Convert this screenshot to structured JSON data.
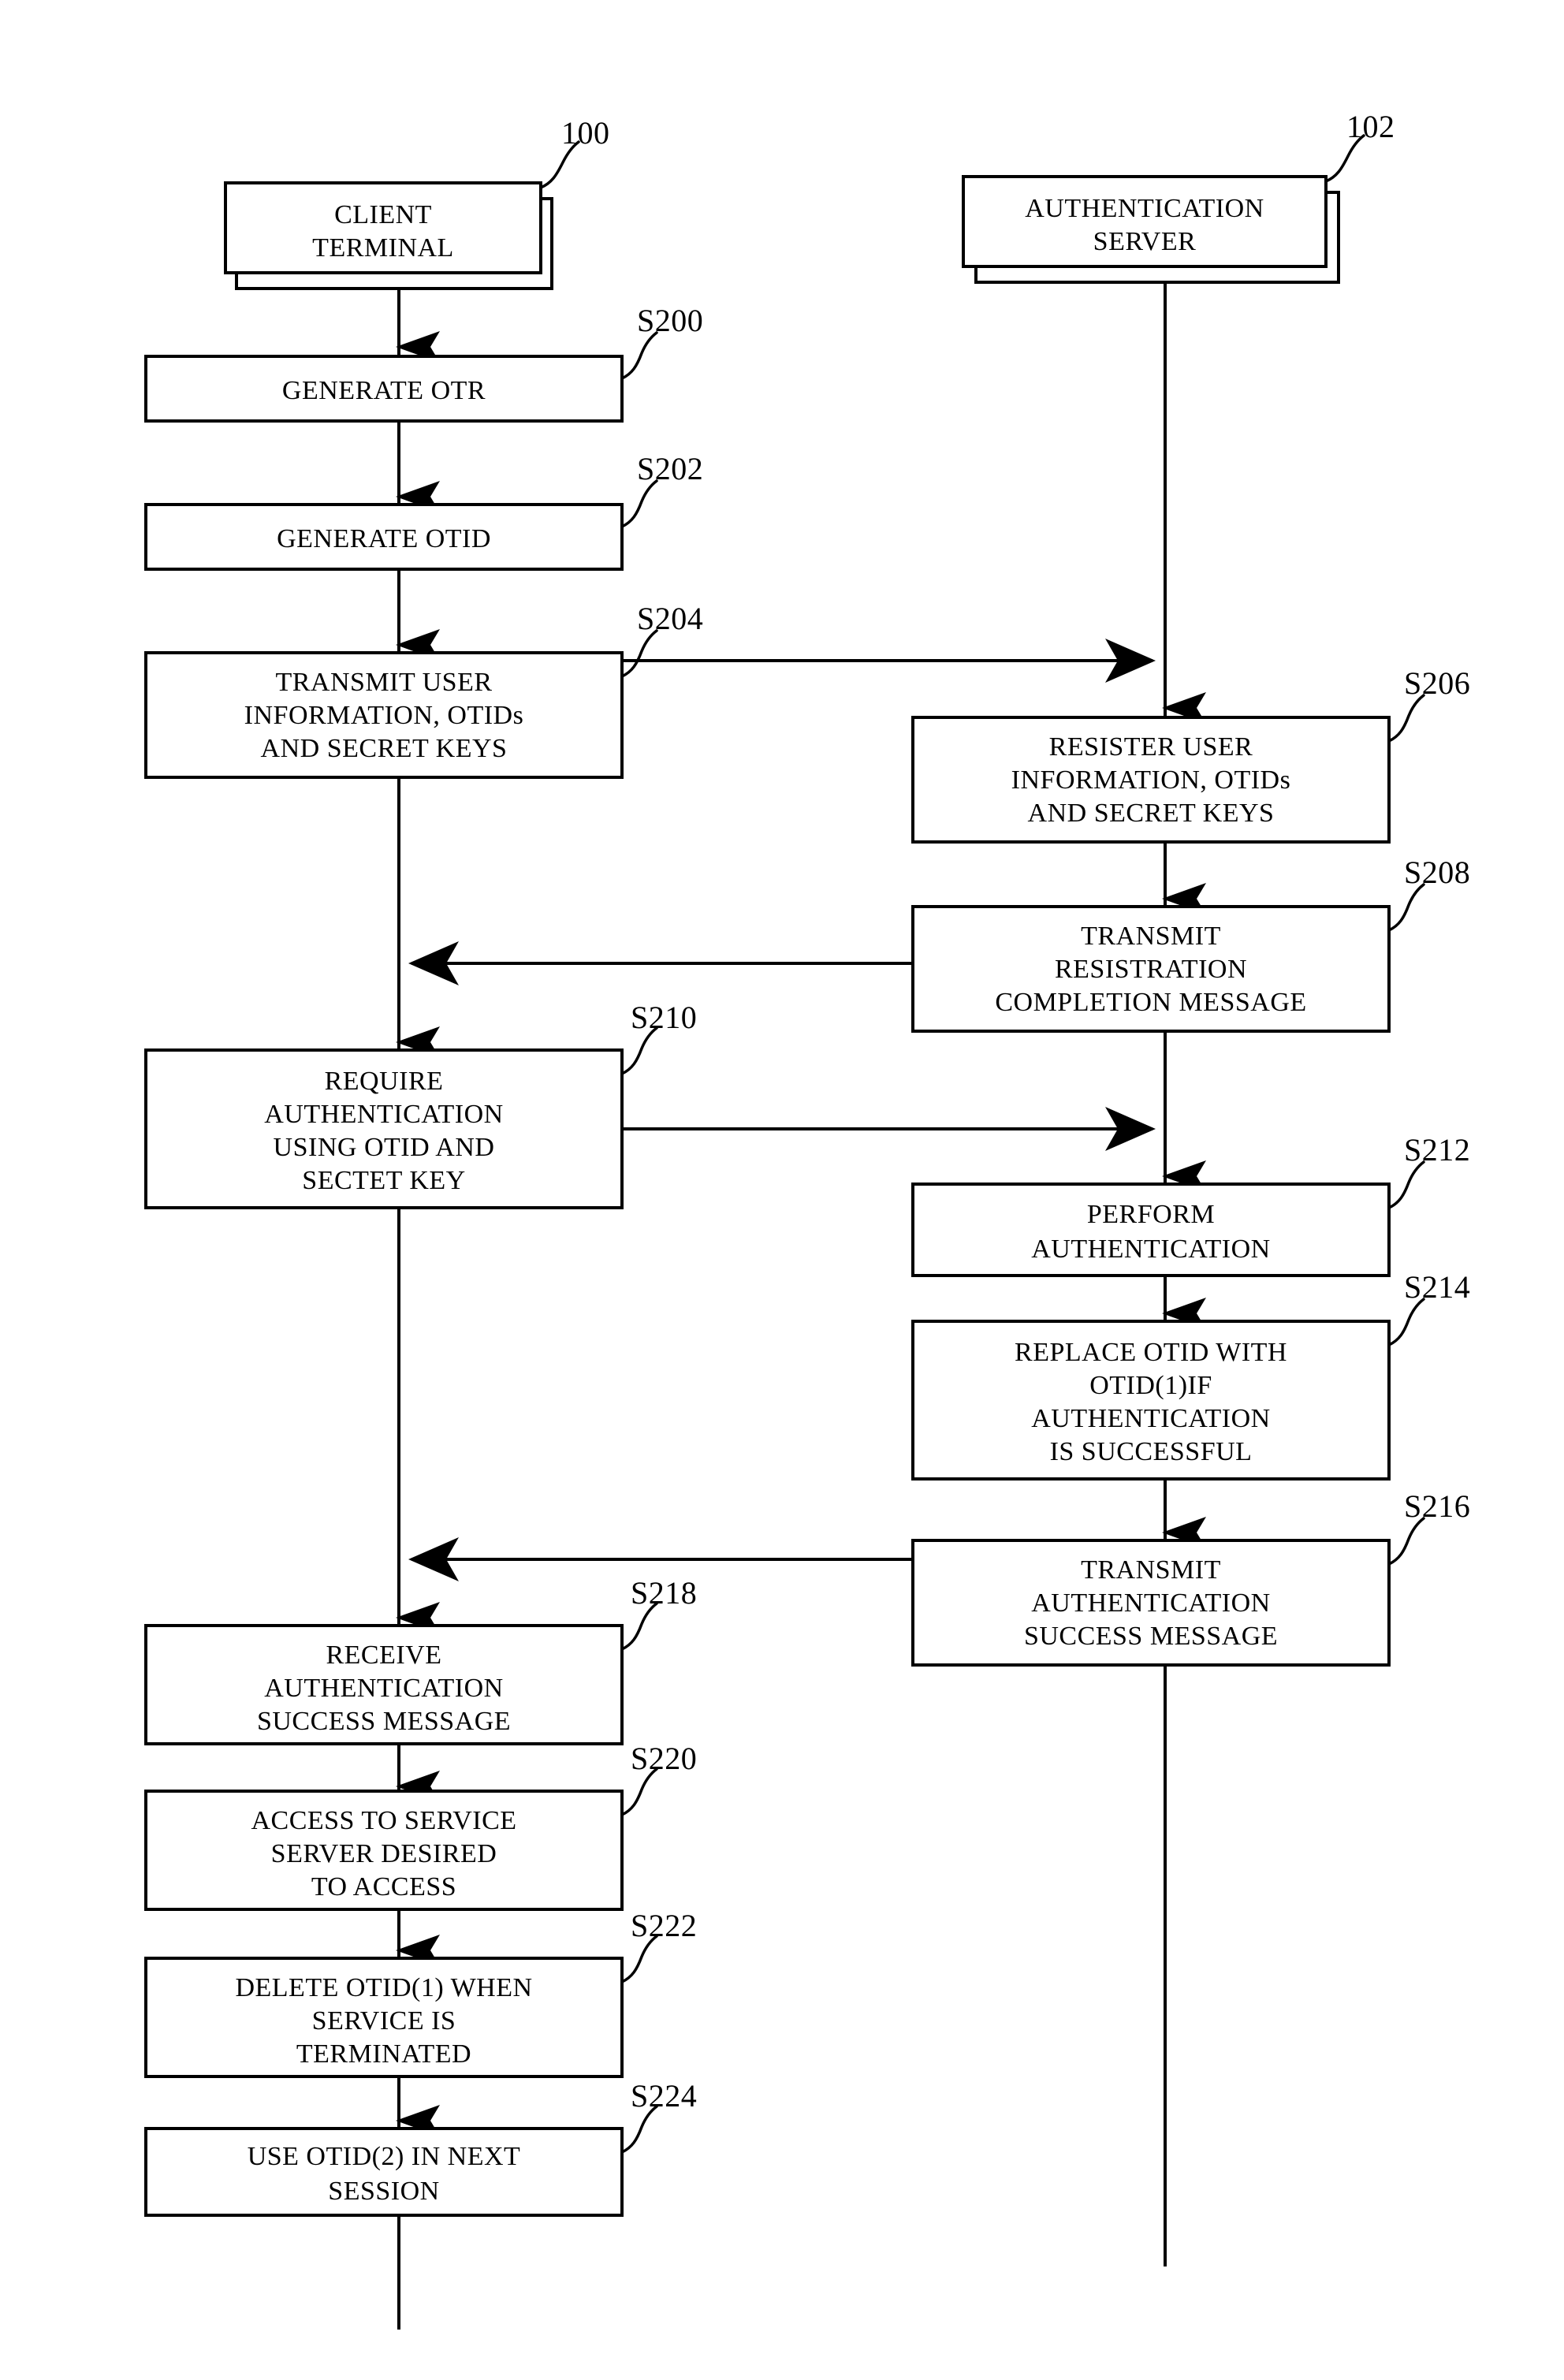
{
  "figure": {
    "type": "patent-flowchart",
    "title": "",
    "background_color": "#ffffff",
    "line_color": "#000000"
  },
  "entities": [
    {
      "id": "client-terminal",
      "ref": "100",
      "lines": [
        "CLIENT",
        "TERMINAL"
      ],
      "lane": "left"
    },
    {
      "id": "authentication-server",
      "ref": "102",
      "lines": [
        "AUTHENTICATION",
        "SERVER"
      ],
      "lane": "right"
    }
  ],
  "steps": [
    {
      "id": "s200",
      "ref": "S200",
      "lane": "left",
      "lines": [
        "GENERATE OTR"
      ]
    },
    {
      "id": "s202",
      "ref": "S202",
      "lane": "left",
      "lines": [
        "GENERATE OTID"
      ]
    },
    {
      "id": "s204",
      "ref": "S204",
      "lane": "left",
      "lines": [
        "TRANSMIT USER",
        "INFORMATION, OTIDs",
        "AND SECRET KEYS"
      ]
    },
    {
      "id": "s206",
      "ref": "S206",
      "lane": "right",
      "lines": [
        "RESISTER USER",
        "INFORMATION, OTIDs",
        "AND SECRET KEYS"
      ]
    },
    {
      "id": "s208",
      "ref": "S208",
      "lane": "right",
      "lines": [
        "TRANSMIT",
        "RESISTRATION",
        "COMPLETION MESSAGE"
      ]
    },
    {
      "id": "s210",
      "ref": "S210",
      "lane": "left",
      "lines": [
        "REQUIRE",
        "AUTHENTICATION",
        "USING OTID AND",
        "SECTET KEY"
      ]
    },
    {
      "id": "s212",
      "ref": "S212",
      "lane": "right",
      "lines": [
        "PERFORM",
        "AUTHENTICATION"
      ]
    },
    {
      "id": "s214",
      "ref": "S214",
      "lane": "right",
      "lines": [
        "REPLACE OTID WITH",
        "OTID(1)IF",
        "AUTHENTICATION",
        "IS SUCCESSFUL"
      ]
    },
    {
      "id": "s216",
      "ref": "S216",
      "lane": "right",
      "lines": [
        "TRANSMIT",
        "AUTHENTICATION",
        "SUCCESS MESSAGE"
      ]
    },
    {
      "id": "s218",
      "ref": "S218",
      "lane": "left",
      "lines": [
        "RECEIVE",
        "AUTHENTICATION",
        "SUCCESS MESSAGE"
      ]
    },
    {
      "id": "s220",
      "ref": "S220",
      "lane": "left",
      "lines": [
        "ACCESS TO SERVICE",
        "SERVER DESIRED",
        "TO ACCESS"
      ]
    },
    {
      "id": "s222",
      "ref": "S222",
      "lane": "left",
      "lines": [
        "DELETE OTID(1) WHEN",
        "SERVICE IS",
        "TERMINATED"
      ]
    },
    {
      "id": "s224",
      "ref": "S224",
      "lane": "left",
      "lines": [
        "USE OTID(2) IN NEXT",
        "SESSION"
      ]
    }
  ],
  "labels": {
    "ref_100": "100",
    "ref_102": "102",
    "ref_s200": "S200",
    "ref_s202": "S202",
    "ref_s204": "S204",
    "ref_s206": "S206",
    "ref_s208": "S208",
    "ref_s210": "S210",
    "ref_s212": "S212",
    "ref_s214": "S214",
    "ref_s216": "S216",
    "ref_s218": "S218",
    "ref_s220": "S220",
    "ref_s222": "S222",
    "ref_s224": "S224",
    "client_l1": "CLIENT",
    "client_l2": "TERMINAL",
    "server_l1": "AUTHENTICATION",
    "server_l2": "SERVER",
    "s200_l1": "GENERATE OTR",
    "s202_l1": "GENERATE OTID",
    "s204_l1": "TRANSMIT USER",
    "s204_l2": "INFORMATION, OTIDs",
    "s204_l3": "AND SECRET KEYS",
    "s206_l1": "RESISTER USER",
    "s206_l2": "INFORMATION, OTIDs",
    "s206_l3": "AND SECRET KEYS",
    "s208_l1": "TRANSMIT",
    "s208_l2": "RESISTRATION",
    "s208_l3": "COMPLETION MESSAGE",
    "s210_l1": "REQUIRE",
    "s210_l2": "AUTHENTICATION",
    "s210_l3": "USING OTID AND",
    "s210_l4": "SECTET KEY",
    "s212_l1": "PERFORM",
    "s212_l2": "AUTHENTICATION",
    "s214_l1": "REPLACE OTID WITH",
    "s214_l2": "OTID(1)IF",
    "s214_l3": "AUTHENTICATION",
    "s214_l4": "IS SUCCESSFUL",
    "s216_l1": "TRANSMIT",
    "s216_l2": "AUTHENTICATION",
    "s216_l3": "SUCCESS MESSAGE",
    "s218_l1": "RECEIVE",
    "s218_l2": "AUTHENTICATION",
    "s218_l3": "SUCCESS MESSAGE",
    "s220_l1": "ACCESS TO SERVICE",
    "s220_l2": "SERVER DESIRED",
    "s220_l3": "TO ACCESS",
    "s222_l1": "DELETE OTID(1) WHEN",
    "s222_l2": "SERVICE IS",
    "s222_l3": "TERMINATED",
    "s224_l1": "USE OTID(2) IN NEXT",
    "s224_l2": "SESSION"
  }
}
